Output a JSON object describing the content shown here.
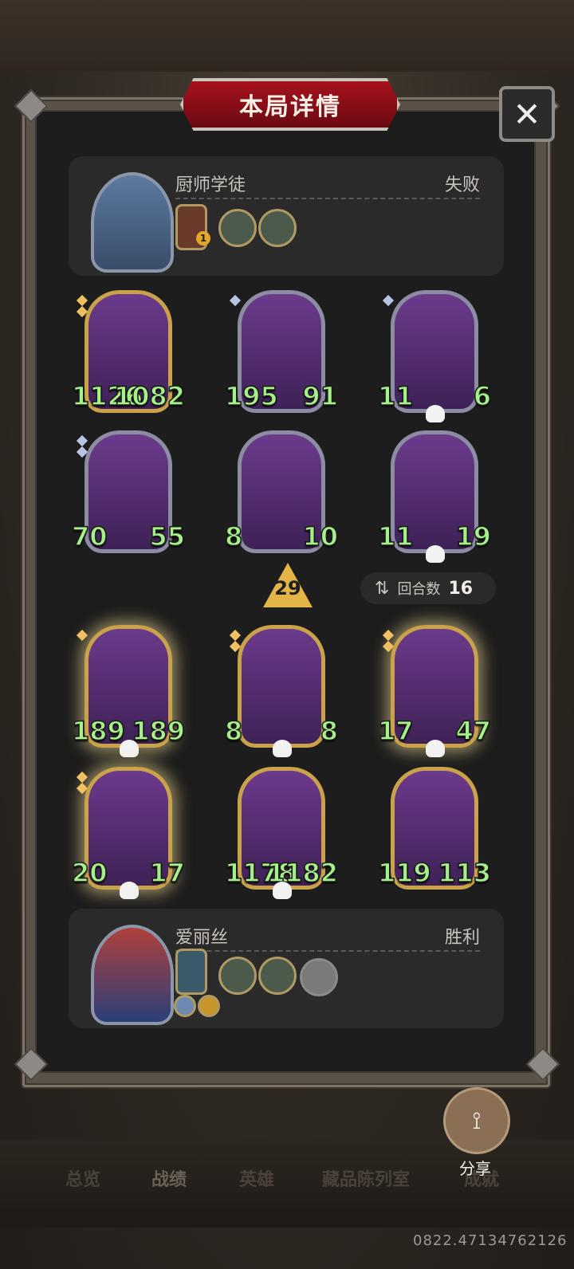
{
  "title": "本局详情",
  "close_label": "✕",
  "top_player": {
    "name": "厨师学徒",
    "result": "失败",
    "item_badge": "1"
  },
  "bottom_player": {
    "name": "爱丽丝",
    "result": "胜利"
  },
  "top_board": [
    {
      "atk": "1126",
      "hp": "1082"
    },
    {
      "atk": "195",
      "hp": "91"
    },
    {
      "atk": "11",
      "hp": "6"
    },
    {
      "atk": "70",
      "hp": "55"
    },
    {
      "atk": "8",
      "hp": "10"
    },
    {
      "atk": "11",
      "hp": "19"
    }
  ],
  "bottom_board": [
    {
      "atk": "189",
      "hp": "189"
    },
    {
      "atk": "8",
      "hp": "8"
    },
    {
      "atk": "17",
      "hp": "47"
    },
    {
      "atk": "20",
      "hp": "17"
    },
    {
      "atk": "1178",
      "hp": "1182"
    },
    {
      "atk": "119",
      "hp": "113"
    }
  ],
  "tier_value": "29",
  "turns": {
    "label": "回合数",
    "value": "16",
    "icon": "swap-arrows-icon"
  },
  "share_label": "分享",
  "nav": [
    "总览",
    "战绩",
    "英雄",
    "藏品陈列室",
    "成就"
  ],
  "stamp": "0822.47134762126"
}
